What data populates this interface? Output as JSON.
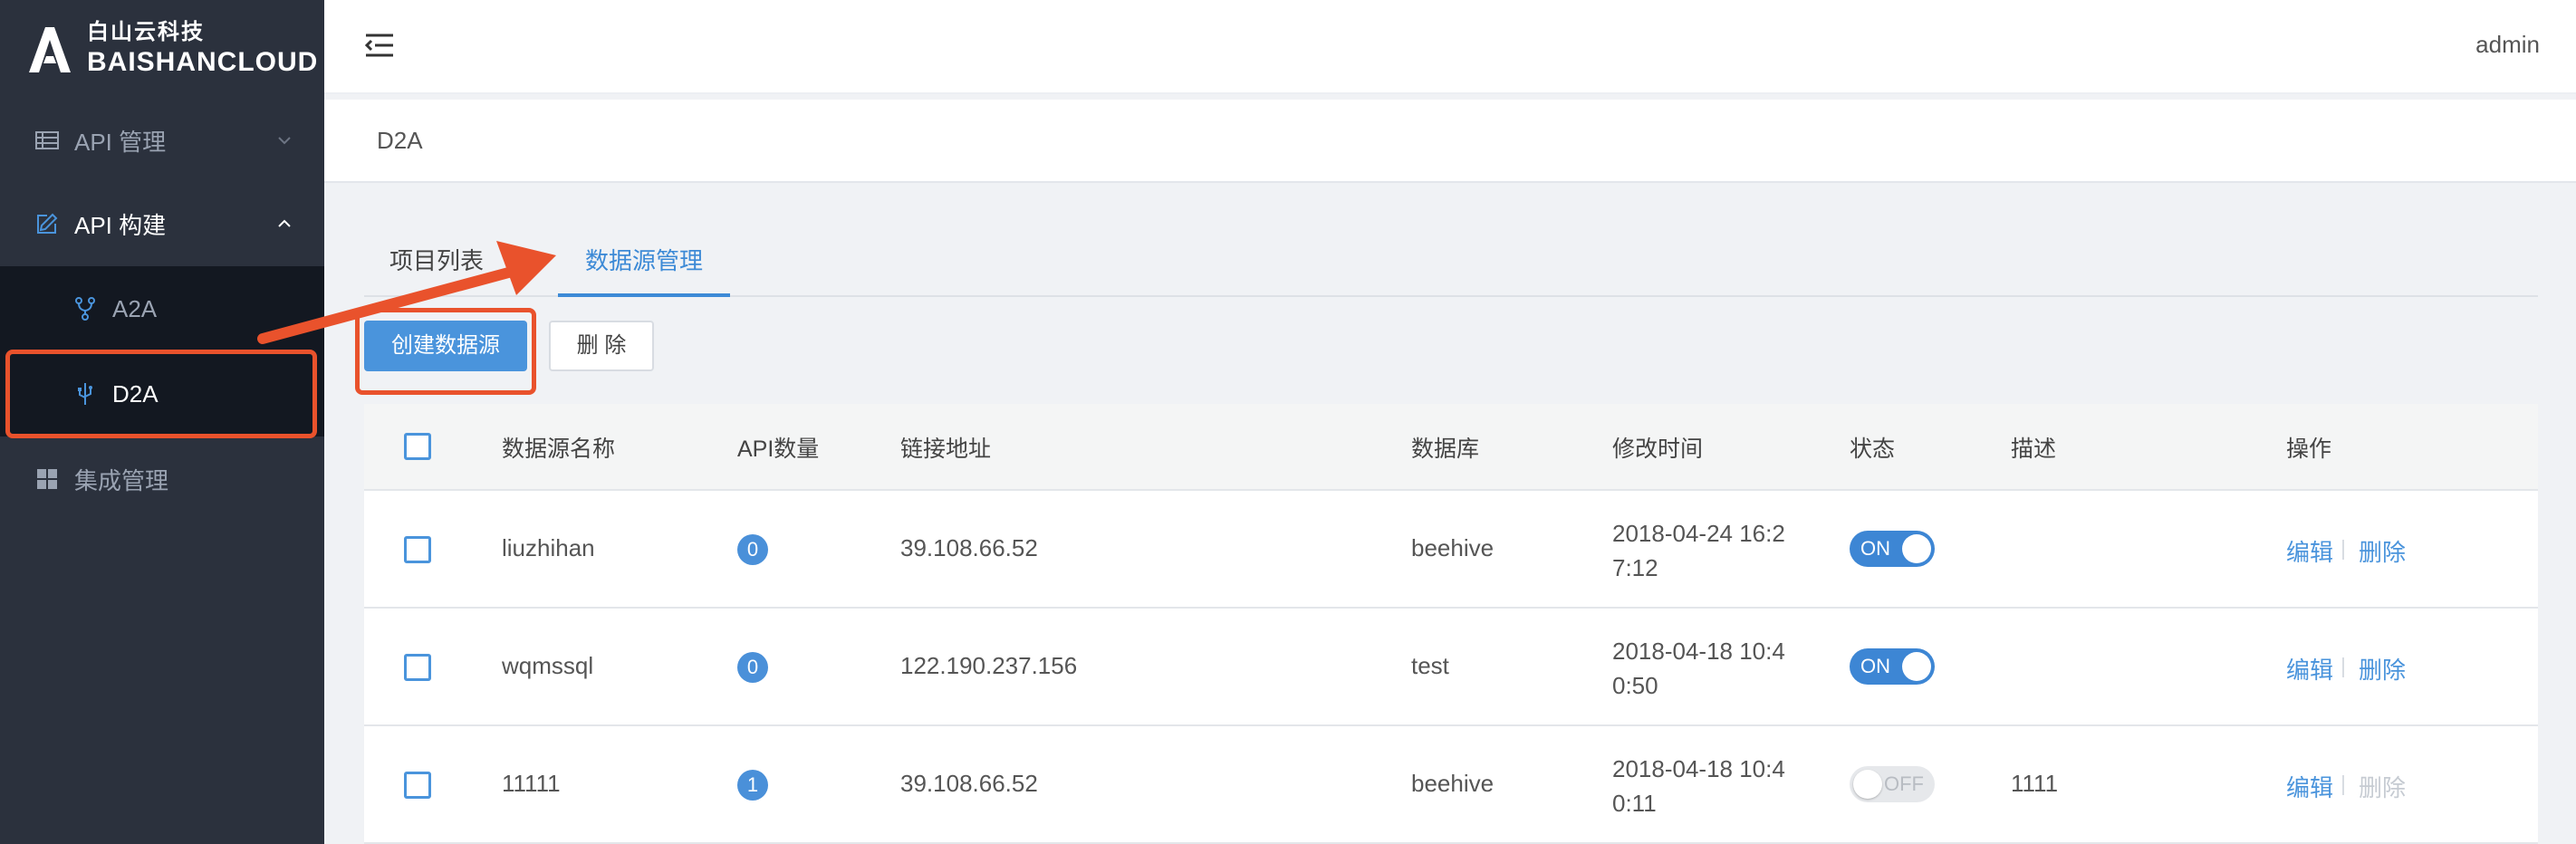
{
  "brand": {
    "name_cn": "白山云科技",
    "name_en": "BAISHANCLOUD"
  },
  "sidebar": {
    "items": [
      {
        "label": "API 管理",
        "icon": "list-icon",
        "expanded": false
      },
      {
        "label": "API 构建",
        "icon": "edit-icon",
        "expanded": true,
        "children": [
          {
            "label": "A2A",
            "icon": "fork-icon",
            "active": false
          },
          {
            "label": "D2A",
            "icon": "usb-icon",
            "active": true
          }
        ]
      },
      {
        "label": "集成管理",
        "icon": "grid-icon",
        "expanded": false
      }
    ]
  },
  "header": {
    "user": "admin"
  },
  "breadcrumb": "D2A",
  "tabs": [
    {
      "label": "项目列表",
      "active": false
    },
    {
      "label": "数据源管理",
      "active": true
    }
  ],
  "toolbar": {
    "create_label": "创建数据源",
    "delete_label": "删 除"
  },
  "table": {
    "columns": [
      "数据源名称",
      "API数量",
      "链接地址",
      "数据库",
      "修改时间",
      "状态",
      "描述",
      "操作"
    ],
    "rows": [
      {
        "name": "liuzhihan",
        "api_count": "0",
        "address": "39.108.66.52",
        "database": "beehive",
        "time_line1": "2018-04-24 16:2",
        "time_line2": "7:12",
        "status": "ON",
        "status_on": true,
        "description": "",
        "edit": "编辑",
        "delete": "删除",
        "delete_enabled": true
      },
      {
        "name": "wqmssql",
        "api_count": "0",
        "address": "122.190.237.156",
        "database": "test",
        "time_line1": "2018-04-18 10:4",
        "time_line2": "0:50",
        "status": "ON",
        "status_on": true,
        "description": "",
        "edit": "编辑",
        "delete": "删除",
        "delete_enabled": true
      },
      {
        "name": "11111",
        "api_count": "1",
        "address": "39.108.66.52",
        "database": "beehive",
        "time_line1": "2018-04-18 10:4",
        "time_line2": "0:11",
        "status": "OFF",
        "status_on": false,
        "description": "1111",
        "edit": "编辑",
        "delete": "删除",
        "delete_enabled": false
      }
    ]
  },
  "colors": {
    "sidebar_bg": "#2b313d",
    "submenu_bg": "#131821",
    "accent": "#4a94dc",
    "annotation": "#e9522c"
  }
}
